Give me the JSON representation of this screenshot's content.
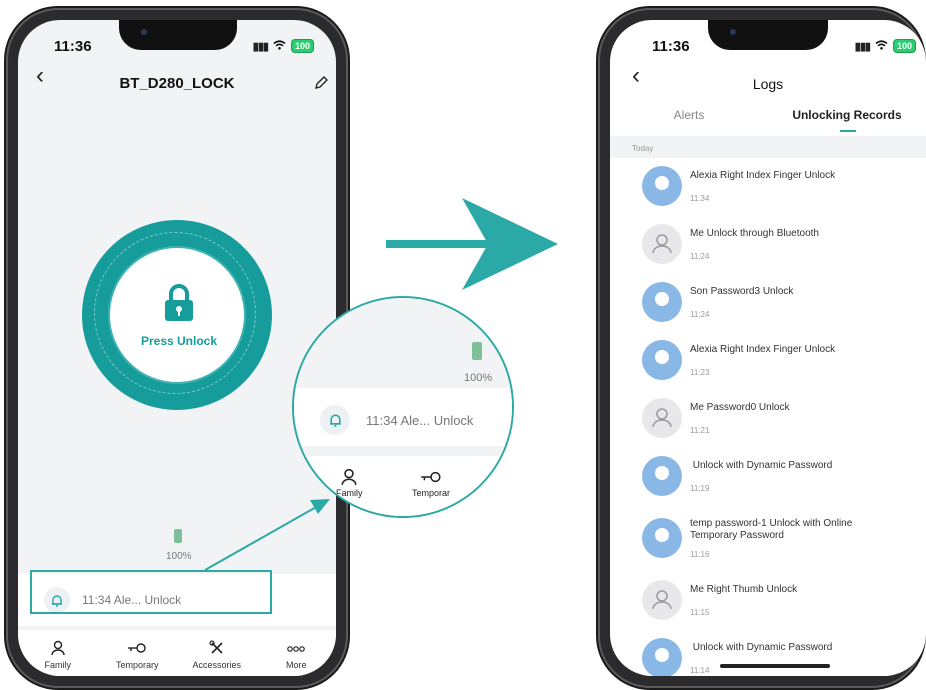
{
  "left_phone": {
    "status_time": "11:36",
    "battery": "100",
    "title": "BT_D280_LOCK",
    "press_unlock_label": "Press Unlock",
    "battery_percent": "100%",
    "alert_text": "11:34 Ale... Unlock",
    "tabs": [
      {
        "label": "Family",
        "icon": "person-icon"
      },
      {
        "label": "Temporary",
        "icon": "key-icon"
      },
      {
        "label": "Accessories",
        "icon": "tools-icon"
      },
      {
        "label": "More",
        "icon": "more-icon"
      }
    ]
  },
  "magnifier": {
    "battery_percent": "100%",
    "alert_text": "11:34 Ale... Unlock",
    "tab1": "Family",
    "tab2": "Temporar"
  },
  "right_phone": {
    "status_time": "11:36",
    "battery": "100",
    "title": "Logs",
    "tabs": [
      {
        "label": "Alerts",
        "active": false
      },
      {
        "label": "Unlocking Records",
        "active": true
      }
    ],
    "section": "Today",
    "records": [
      {
        "title": "Alexia Right Index Finger  Unlock",
        "time": "11:34",
        "avatar": "blue"
      },
      {
        "title": "Me Unlock through Bluetooth",
        "time": "11:24",
        "avatar": "gray"
      },
      {
        "title": "Son Password3  Unlock",
        "time": "11:24",
        "avatar": "blue"
      },
      {
        "title": "Alexia Right Index Finger  Unlock",
        "time": "11:23",
        "avatar": "blue"
      },
      {
        "title": "Me Password0  Unlock",
        "time": "11:21",
        "avatar": "gray"
      },
      {
        "title": " Unlock with Dynamic Password",
        "time": "11:19",
        "avatar": "blue"
      },
      {
        "title": "temp password-1 Unlock with Online Temporary Password",
        "time": "11:16",
        "avatar": "blue"
      },
      {
        "title": "Me Right Thumb  Unlock",
        "time": "11:15",
        "avatar": "gray"
      },
      {
        "title": " Unlock with Dynamic Password",
        "time": "11:14",
        "avatar": "blue"
      }
    ]
  },
  "colors": {
    "accent": "#169d9b",
    "arrow": "#2aa9a6",
    "avatar_blue": "#8ab8e6"
  }
}
